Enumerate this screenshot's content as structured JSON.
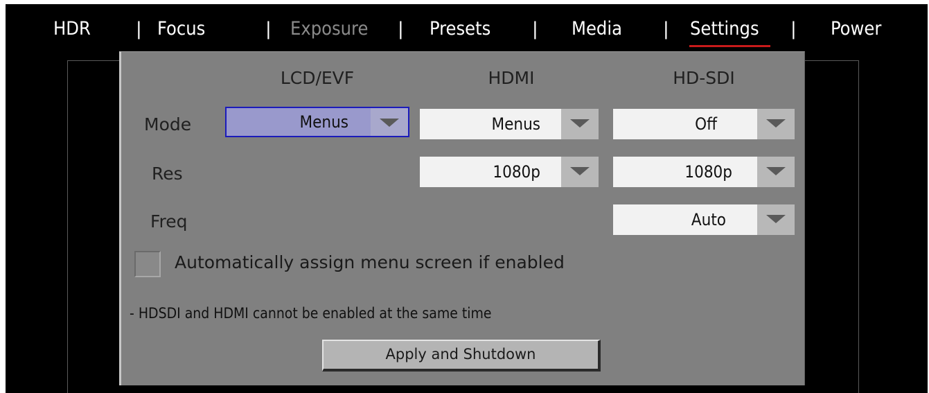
{
  "nav": {
    "items": [
      {
        "label": "HDR",
        "state": "normal"
      },
      {
        "label": "Focus",
        "state": "normal"
      },
      {
        "label": "Exposure",
        "state": "disabled"
      },
      {
        "label": "Presets",
        "state": "normal"
      },
      {
        "label": "Media",
        "state": "normal"
      },
      {
        "label": "Settings",
        "state": "active"
      },
      {
        "label": "Power",
        "state": "normal"
      }
    ],
    "separator": "|",
    "active_color": "#c81a1a"
  },
  "panel": {
    "columns": [
      "LCD/EVF",
      "HDMI",
      "HD-SDI"
    ],
    "rows": {
      "mode": {
        "label": "Mode",
        "lcd_evf": "Menus",
        "hdmi": "Menus",
        "hd_sdi": "Off"
      },
      "res": {
        "label": "Res",
        "hdmi": "1080p",
        "hd_sdi": "1080p"
      },
      "freq": {
        "label": "Freq",
        "hd_sdi": "Auto"
      }
    },
    "auto_assign": {
      "label": "Automatically assign menu screen if enabled",
      "checked": false
    },
    "note": "- HDSDI and HDMI cannot be enabled at the same time",
    "apply_button": "Apply and Shutdown"
  },
  "icons": {
    "dropdown": "chevron-down-icon"
  },
  "colors": {
    "panel_bg": "#808080",
    "selected_bg": "#9999cc",
    "selected_border": "#1b1bbb"
  }
}
